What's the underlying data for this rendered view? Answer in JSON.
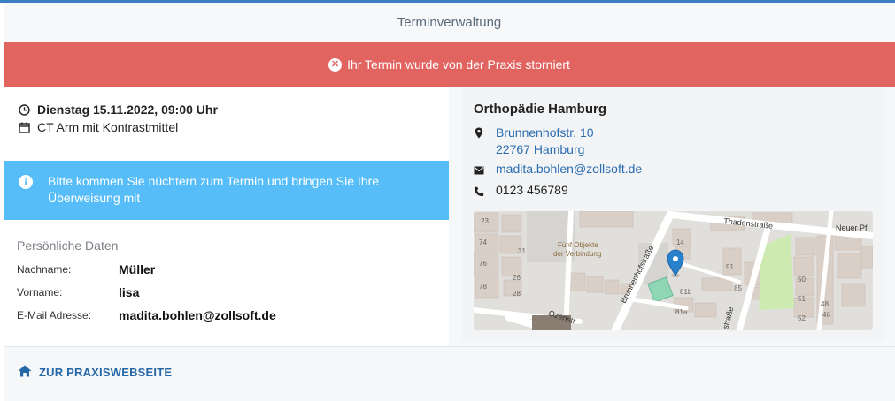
{
  "header": {
    "title": "Terminverwaltung"
  },
  "alert": {
    "icon": "x-circle-icon",
    "text": "Ihr Termin wurde von der Praxis storniert",
    "color": "#e16461"
  },
  "appointment": {
    "datetime": "Dienstag 15.11.2022, 09:00 Uhr",
    "service": "CT Arm mit Kontrastmittel",
    "icons": [
      "clock-icon",
      "calendar-icon"
    ]
  },
  "notice": {
    "icon": "info-icon",
    "text": "Bitte kommen Sie nüchtern zum Termin und bringen Sie Ihre Überweisung mit",
    "color": "#56bdf8"
  },
  "personal": {
    "heading": "Persönliche Daten",
    "fields": [
      {
        "label": "Nachname:",
        "value": "Müller"
      },
      {
        "label": "Vorname:",
        "value": "lisa"
      },
      {
        "label": "E-Mail Adresse:",
        "value": "madita.bohlen@zollsoft.de"
      }
    ]
  },
  "practice": {
    "name": "Orthopädie Hamburg",
    "street": "Brunnenhofstr. 10",
    "city": "22767 Hamburg",
    "email": "madita.bohlen@zollsoft.de",
    "phone": "0123 456789"
  },
  "map": {
    "labels": {
      "poi": "Fünf Objekte der Verbindung",
      "street1": "Brunnenhofstraße",
      "street2": "Thadenstraße",
      "street3": "Neuer Pf",
      "street4": "Ozenstr",
      "street5": "straße"
    },
    "house_numbers": [
      "74",
      "76",
      "78",
      "26",
      "28",
      "14",
      "91",
      "85",
      "81b",
      "81a",
      "51",
      "48",
      "46",
      "23",
      "31",
      "50",
      "52"
    ]
  },
  "footer": {
    "link_label": "ZUR PRAXISWEBSEITE",
    "icon": "home-icon"
  }
}
